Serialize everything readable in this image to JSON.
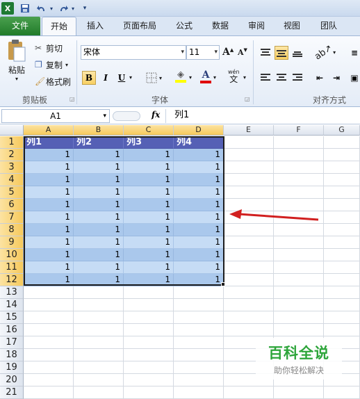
{
  "quick_access": {
    "more": "▾"
  },
  "tabs": [
    "文件",
    "开始",
    "插入",
    "页面布局",
    "公式",
    "数据",
    "审阅",
    "视图",
    "团队"
  ],
  "ribbon": {
    "clipboard": {
      "paste": "粘贴",
      "cut": "剪切",
      "copy": "复制",
      "format_painter": "格式刷",
      "label": "剪贴板"
    },
    "font": {
      "name": "宋体",
      "size": "11",
      "grow": "A",
      "shrink": "A",
      "bold": "B",
      "italic": "I",
      "underline": "U",
      "label": "字体",
      "font_color_letter": "A",
      "phonetic_top": "wén",
      "phonetic_bottom": "文"
    },
    "alignment": {
      "label": "对齐方式"
    }
  },
  "formula_bar": {
    "name_box": "A1",
    "fx": "fx",
    "formula": "列1"
  },
  "columns": [
    "A",
    "B",
    "C",
    "D",
    "E",
    "F",
    "G"
  ],
  "rows": [
    "1",
    "2",
    "3",
    "4",
    "5",
    "6",
    "7",
    "8",
    "9",
    "10",
    "11",
    "12",
    "13",
    "14",
    "15",
    "16",
    "17",
    "18",
    "19",
    "20",
    "21"
  ],
  "table": {
    "headers": [
      "列1",
      "列2",
      "列3",
      "列4"
    ],
    "rows": [
      [
        "1",
        "1",
        "1",
        "1"
      ],
      [
        "1",
        "1",
        "1",
        "1"
      ],
      [
        "1",
        "1",
        "1",
        "1"
      ],
      [
        "1",
        "1",
        "1",
        "1"
      ],
      [
        "1",
        "1",
        "1",
        "1"
      ],
      [
        "1",
        "1",
        "1",
        "1"
      ],
      [
        "1",
        "1",
        "1",
        "1"
      ],
      [
        "1",
        "1",
        "1",
        "1"
      ],
      [
        "1",
        "1",
        "1",
        "1"
      ],
      [
        "1",
        "1",
        "1",
        "1"
      ],
      [
        "1",
        "1",
        "1",
        "1"
      ]
    ]
  },
  "watermark": {
    "title": "百科全说",
    "subtitle": "助你轻松解决"
  },
  "colors": {
    "header": "#5560b5",
    "band1": "#aac8ec",
    "band2": "#c6dcf5",
    "arrow": "#d11f1f",
    "file_tab": "#217b2a"
  }
}
